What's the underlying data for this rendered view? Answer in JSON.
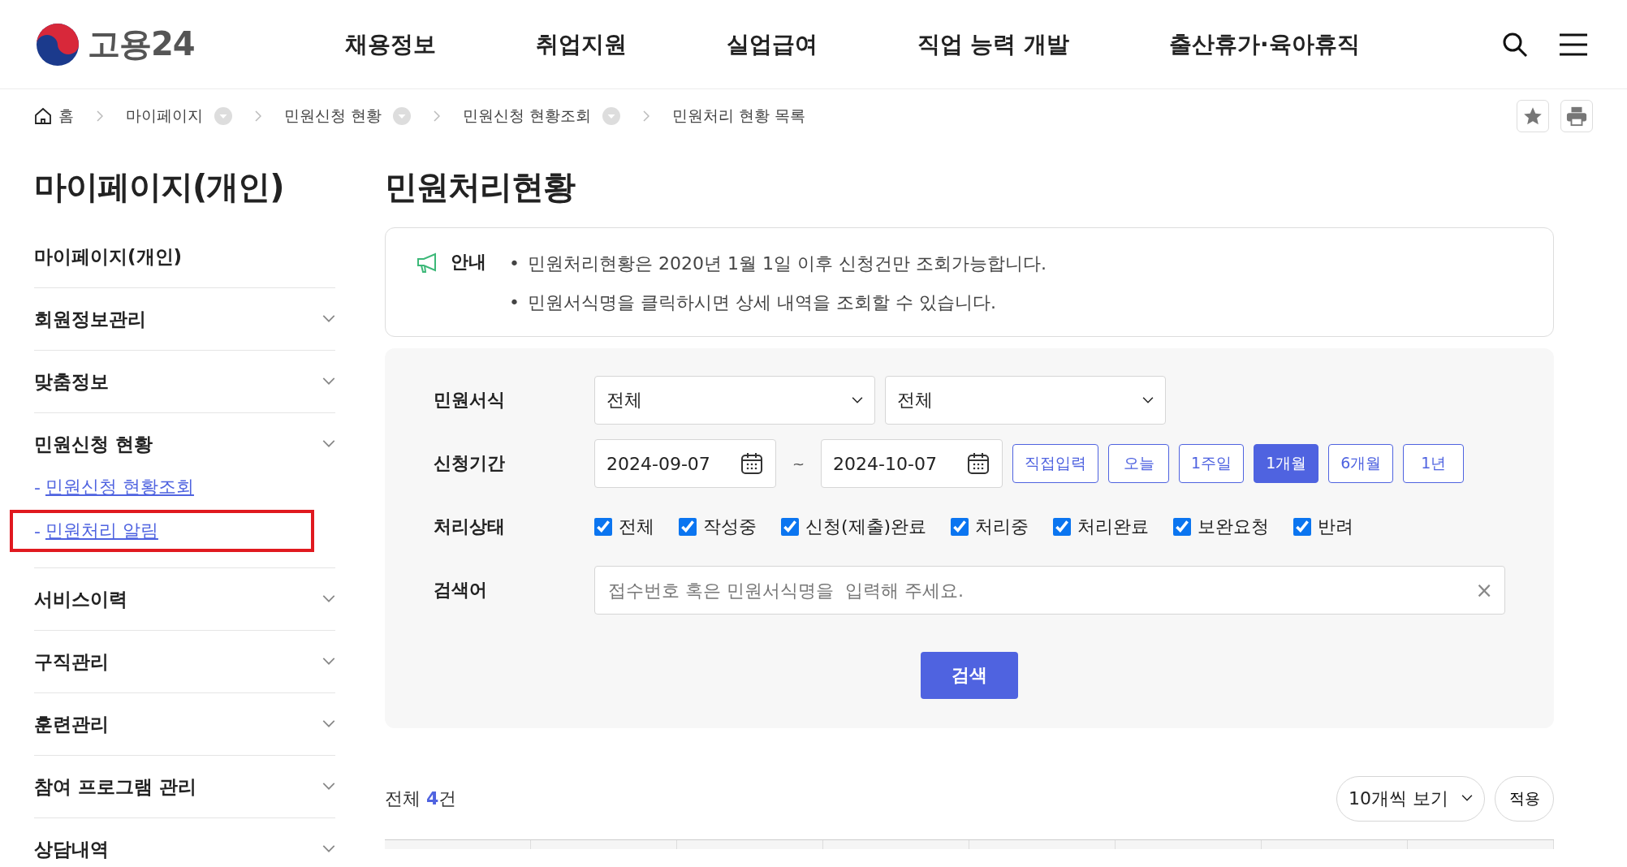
{
  "header": {
    "logo_text": "고용24",
    "nav": [
      "채용정보",
      "취업지원",
      "실업급여",
      "직업 능력 개발",
      "출산휴가·육아휴직"
    ]
  },
  "breadcrumb": [
    {
      "label": "홈",
      "kind": "home"
    },
    {
      "label": "마이페이지",
      "kind": "dropdown"
    },
    {
      "label": "민원신청 현황",
      "kind": "dropdown"
    },
    {
      "label": "민원신청 현황조회",
      "kind": "dropdown"
    },
    {
      "label": "민원처리 현황 목록",
      "kind": "plain"
    }
  ],
  "sidebar": {
    "title": "마이페이지(개인)",
    "items": [
      {
        "label": "마이페이지(개인)",
        "expandable": false
      },
      {
        "label": "회원정보관리",
        "expandable": true
      },
      {
        "label": "맞춤정보",
        "expandable": true
      },
      {
        "label": "민원신청 현황",
        "expandable": true,
        "children": [
          {
            "prefix": "-",
            "label": "민원신청 현황조회",
            "highlighted": false
          },
          {
            "prefix": "-",
            "label": "민원처리 알림",
            "highlighted": true
          }
        ]
      },
      {
        "label": "서비스이력",
        "expandable": true
      },
      {
        "label": "구직관리",
        "expandable": true
      },
      {
        "label": "훈련관리",
        "expandable": true
      },
      {
        "label": "참여 프로그램 관리",
        "expandable": true
      },
      {
        "label": "상담내역",
        "expandable": true
      }
    ]
  },
  "page_title": "민원처리현황",
  "notice": {
    "label": "안내",
    "bullet": "•",
    "lines": [
      "민원처리현황은 2020년 1월 1일 이후 신청건만 조회가능합니다.",
      "민원서식명을 클릭하시면 상세 내역을 조회할 수 있습니다."
    ]
  },
  "form": {
    "rows": [
      {
        "kind": "selects",
        "label": "민원서식",
        "selects": [
          "전체",
          "전체"
        ]
      },
      {
        "kind": "period",
        "label": "신청기간",
        "from": "2024-09-07",
        "separator": "~",
        "to": "2024-10-07",
        "buttons": [
          {
            "label": "직접입력",
            "selected": false
          },
          {
            "label": "오늘",
            "selected": false
          },
          {
            "label": "1주일",
            "selected": false
          },
          {
            "label": "1개월",
            "selected": true
          },
          {
            "label": "6개월",
            "selected": false
          },
          {
            "label": "1년",
            "selected": false
          }
        ]
      },
      {
        "kind": "checks",
        "label": "처리상태",
        "options": [
          {
            "label": "전체",
            "checked": true
          },
          {
            "label": "작성중",
            "checked": true
          },
          {
            "label": "신청(제출)완료",
            "checked": true
          },
          {
            "label": "처리중",
            "checked": true
          },
          {
            "label": "처리완료",
            "checked": true
          },
          {
            "label": "보완요청",
            "checked": true
          },
          {
            "label": "반려",
            "checked": true
          }
        ]
      },
      {
        "kind": "search",
        "label": "검색어",
        "placeholder": "접수번호 혹은 민원서식명을  입력해 주세요.",
        "clear": "×"
      }
    ],
    "submit": "검색"
  },
  "results": {
    "total": "전체 **4**건",
    "page_size": "10개씩 보기",
    "apply": "적용"
  }
}
